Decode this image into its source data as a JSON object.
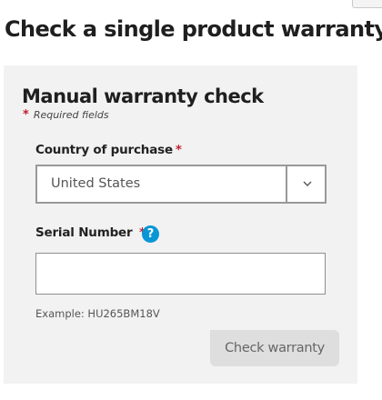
{
  "page": {
    "title": "Check a single product warranty"
  },
  "form": {
    "title": "Manual warranty check",
    "required_star": "*",
    "required_note": "Required fields",
    "country": {
      "label": "Country of purchase",
      "required_star": "*",
      "selected_value": "United States",
      "icon": "chevron-down-icon"
    },
    "serial": {
      "label": "Serial Number",
      "required_star": "*",
      "help_icon_glyph": "?",
      "value": "",
      "example": "Example: HU265BM18V"
    },
    "submit": {
      "label": "Check warranty",
      "state": "disabled"
    }
  },
  "colors": {
    "required_star": "#c21f2f",
    "help_icon": "#0a96d6",
    "panel_background": "#f2f2f2",
    "button_disabled_background": "#dedede"
  }
}
